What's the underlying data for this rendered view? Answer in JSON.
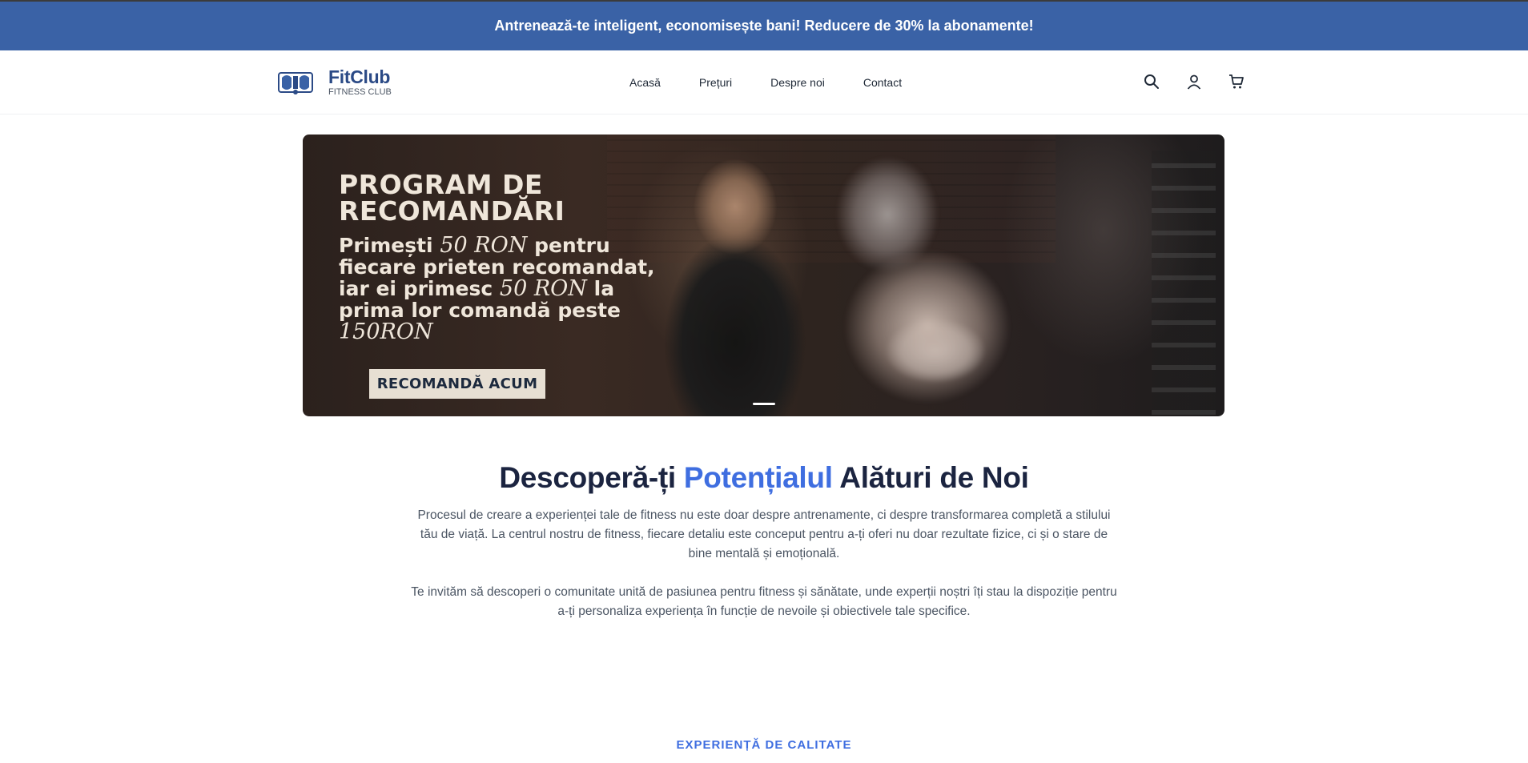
{
  "promo": {
    "text": "Antrenează-te inteligent, economisește bani! Reducere de 30% la abonamente!"
  },
  "header": {
    "logo_name": "FitClub",
    "logo_sub": "FITNESS CLUB",
    "nav": [
      "Acasă",
      "Prețuri",
      "Despre noi",
      "Contact"
    ],
    "icons": [
      "search-icon",
      "user-icon",
      "cart-icon"
    ]
  },
  "hero": {
    "title_line1": "PROGRAM DE",
    "title_line2": "RECOMANDĂRI",
    "body_a": "Primești ",
    "amount1": "50 RON",
    "body_b": " pentru fiecare prieten recomandat, iar ei primesc ",
    "amount2": "50 RON",
    "body_c": " la prima lor comandă peste ",
    "amount3": "150RON",
    "cta": "RECOMANDĂ ACUM"
  },
  "intro": {
    "title_before": "Descoperă-ți ",
    "title_accent": "Potențialul",
    "title_after": " Alături de Noi",
    "paragraph1": "Procesul de creare a experienței tale de fitness nu este doar despre antrenamente, ci despre transformarea completă a stilului tău de viață. La centrul nostru de fitness, fiecare detaliu este conceput pentru a-ți oferi nu doar rezultate fizice, ci și o stare de bine mentală și emoțională.",
    "paragraph2": "Te invităm să descoperi o comunitate unită de pasiunea pentru fitness și sănătate, unde experții noștri îți stau la dispoziție pentru a-ți personaliza experiența în funcție de nevoile și obiectivele tale specifice."
  },
  "section": {
    "eyebrow": "EXPERIENȚĂ DE CALITATE"
  },
  "colors": {
    "promo_bg": "#3a62a6",
    "accent": "#3f6ee0",
    "brand": "#2b4a86",
    "heading": "#1b2440"
  }
}
